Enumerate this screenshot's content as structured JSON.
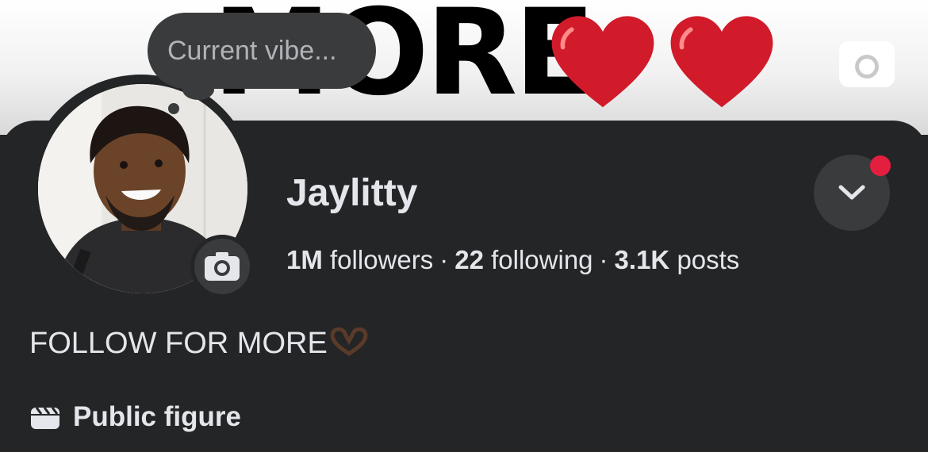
{
  "cover": {
    "text": "MORE",
    "camera_icon": "camera-icon"
  },
  "vibe": {
    "placeholder": "Current vibe..."
  },
  "profile": {
    "name": "Jaylitty",
    "followers_count": "1M",
    "followers_label": "followers",
    "following_count": "22",
    "following_label": "following",
    "posts_count": "3.1K",
    "posts_label": "posts",
    "separator": "·"
  },
  "bio": "FOLLOW FOR MORE",
  "category": {
    "label": "Public figure",
    "icon": "clapperboard-icon"
  },
  "colors": {
    "background": "#242526",
    "surface": "#3a3b3c",
    "notification": "#e41e3f"
  }
}
